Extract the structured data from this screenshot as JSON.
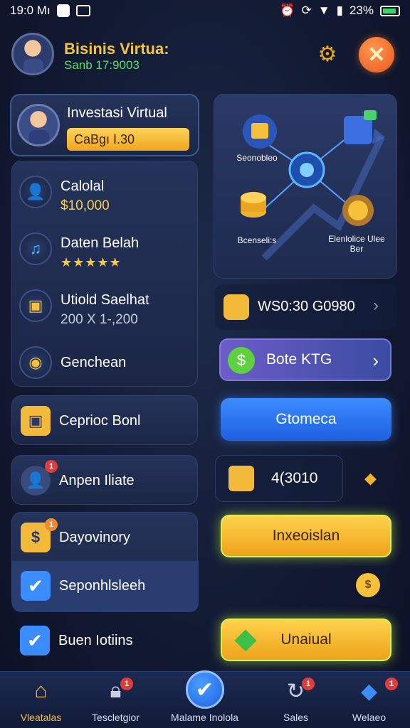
{
  "status_bar": {
    "time": "19:0 Mı",
    "battery": "23%"
  },
  "header": {
    "title": "Bisinis Virtua:",
    "subtitle": "Sanb 17:9003"
  },
  "profile": {
    "title": "Investasi Virtual",
    "badge": "CaBgı I.30"
  },
  "stats": [
    {
      "label": "Calolal",
      "value": "$10,000",
      "icon": "avatar-icon"
    },
    {
      "label": "Daten Belah",
      "stars": "★★★★★",
      "icon": "music-icon"
    },
    {
      "label": "Utiold Saelhat",
      "value": "200 X 1-,200",
      "icon": "coin-icon"
    },
    {
      "label": "Genchean",
      "icon": "wallet-icon"
    }
  ],
  "network": {
    "labels": [
      "Seonobleo",
      "Bcenseli:s",
      "Elenlolice Ulee Ber"
    ]
  },
  "right_panel": {
    "balance_row": "WS0:30 G0980",
    "purple_button": "Bote KTG",
    "blue_button": "Gtomeca",
    "value_box": "4(3010",
    "gold_button_1": "Inxeoislan",
    "gold_button_2": "Unaiual"
  },
  "list": [
    {
      "label": "Ceprioc Bonl",
      "icon": "briefcase-icon"
    },
    {
      "label": "Anpen Iliate",
      "icon": "person-icon",
      "badge": "1"
    },
    {
      "label": "Dayovinory",
      "icon": "dollar-icon",
      "badge": "1"
    },
    {
      "label": "Seponhlsleeh",
      "icon": "checkbox-icon"
    },
    {
      "label": "Buen Iotiins",
      "icon": "checkbox-icon"
    }
  ],
  "bottom_nav": [
    {
      "label": "Vleatalas",
      "icon": "home-icon"
    },
    {
      "label": "Tescletgior",
      "icon": "lock-icon",
      "badge": "1"
    },
    {
      "label": "Malame Inolola",
      "icon": "check-icon"
    },
    {
      "label": "Sales",
      "icon": "refresh-icon",
      "badge": "1"
    },
    {
      "label": "Welaeo",
      "icon": "fish-icon",
      "badge": "1"
    }
  ],
  "colors": {
    "accent_gold": "#f3c53b",
    "accent_green": "#5fdc6e",
    "accent_blue": "#3b8cff",
    "bg": "#121a33"
  }
}
